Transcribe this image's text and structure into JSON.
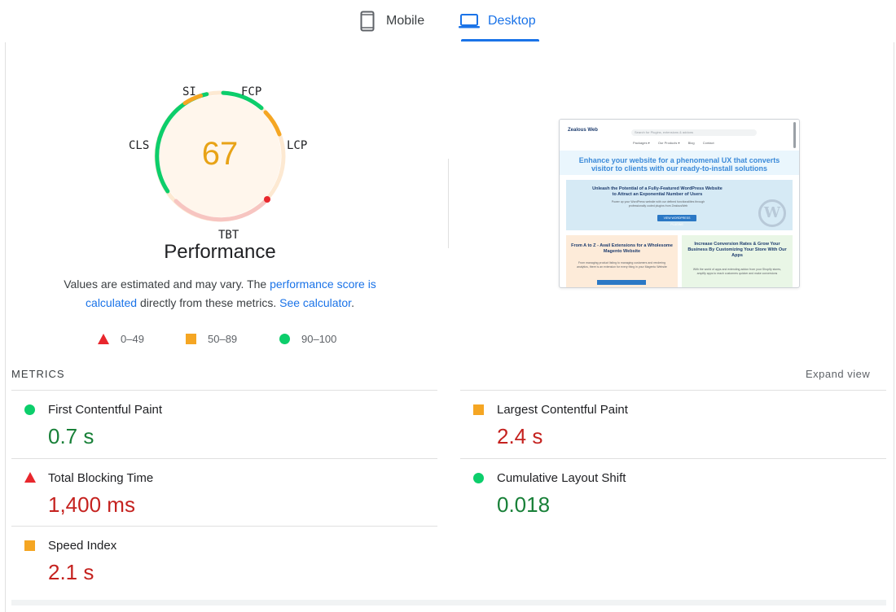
{
  "tabs": {
    "mobile_label": "Mobile",
    "desktop_label": "Desktop",
    "active": "Desktop"
  },
  "gauge": {
    "score": "67",
    "score_color": "#e8a317",
    "labels": {
      "si": "SI",
      "fcp": "FCP",
      "lcp": "LCP",
      "tbt": "TBT",
      "cls": "CLS"
    },
    "title": "Performance"
  },
  "description": {
    "text1": "Values are estimated and may vary. The ",
    "link1": "performance score is calculated",
    "text2": " directly from these metrics. ",
    "link2": "See calculator",
    "text3": "."
  },
  "legend": {
    "poor": "0–49",
    "average": "50–89",
    "good": "90–100"
  },
  "thumbnail": {
    "logo": "Zealous Web",
    "search": "Search for Plugins, extensions & addons",
    "nav": [
      "Packages ▾",
      "Our Products ▾",
      "Blog",
      "Contact"
    ],
    "hero": "Enhance your website for a phenomenal UX that converts visitor to clients with our ready-to-install solutions",
    "band_title": "Unleash the Potential of a Fully-Featured WordPress Website to Attract an Exponential Number of Users",
    "band_sub": "Power up your WordPress website with our defined functionalities through professionally coded plugins from ZealousWeb",
    "band_button": "VIEW WORDPRESS PLUGINS",
    "card1_title": "From A to Z - Avail Extensions for a Wholesome Magento Website",
    "card1_sub": "From managing product listing to managing customers and rendering analytics, there is an extension for every thing in your Magento Website",
    "card2_title": "Increase Conversion Rates & Grow Your Business By Customizing Your Store With Our Apps",
    "card2_sub": "With the world of apps and extending addon from your Shopify stores, amplify apps to reach customers quicker and make conversions",
    "wp_letter": "W"
  },
  "metrics": {
    "header": "METRICS",
    "expand": "Expand view",
    "items": [
      {
        "name": "First Contentful Paint",
        "value": "0.7 s",
        "status": "good"
      },
      {
        "name": "Largest Contentful Paint",
        "value": "2.4 s",
        "status": "average"
      },
      {
        "name": "Total Blocking Time",
        "value": "1,400 ms",
        "status": "poor"
      },
      {
        "name": "Cumulative Layout Shift",
        "value": "0.018",
        "status": "good"
      },
      {
        "name": "Speed Index",
        "value": "2.1 s",
        "status": "average"
      }
    ]
  },
  "colors": {
    "good": "#0cce6b",
    "average": "#f5a623",
    "poor": "#e8272d",
    "link": "#1a73e8"
  }
}
